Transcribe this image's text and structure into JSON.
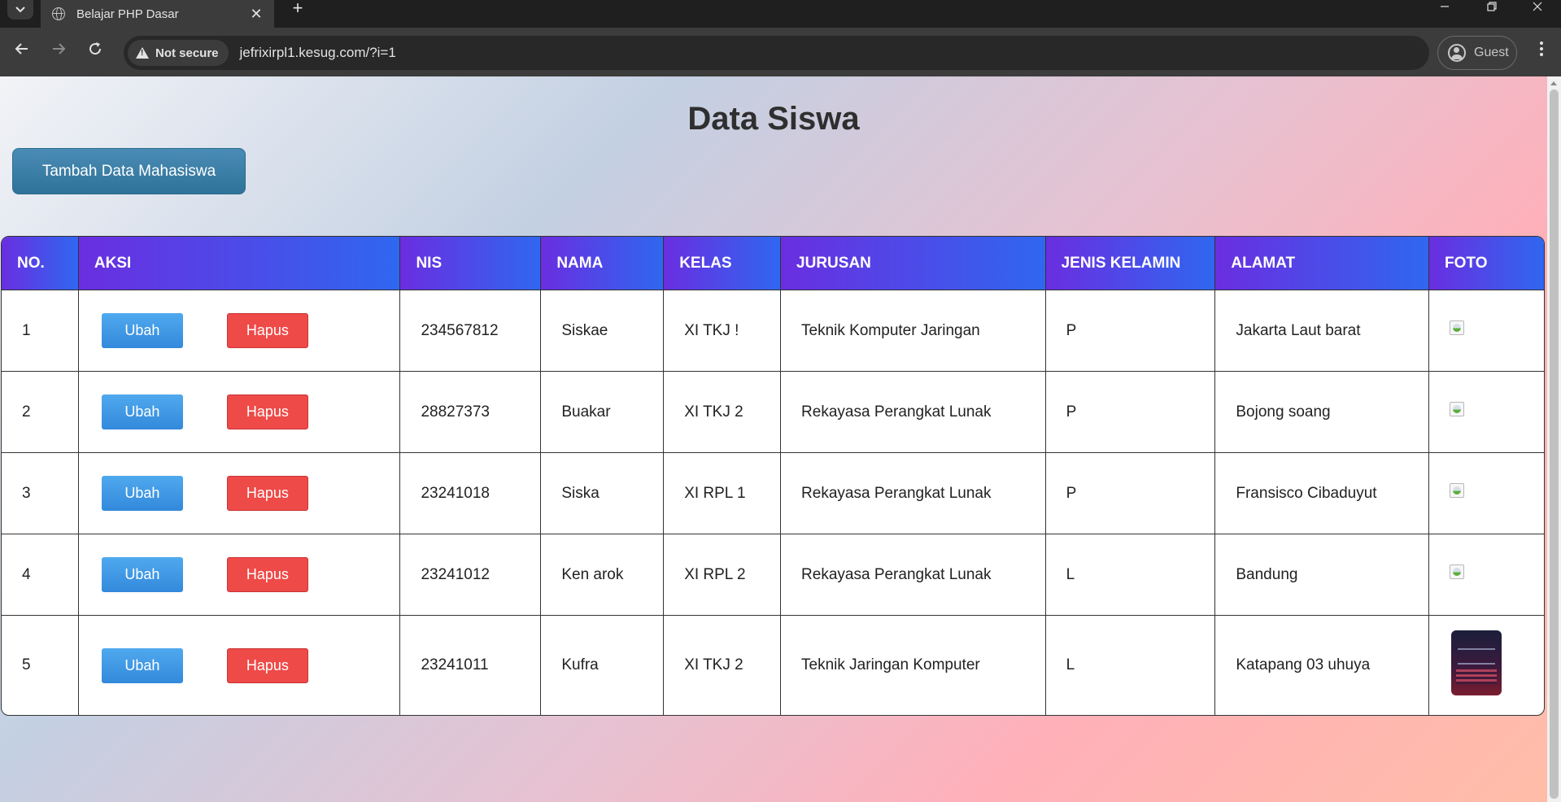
{
  "browser": {
    "tab_title": "Belajar PHP Dasar",
    "tab_close": "✕",
    "new_tab": "+",
    "security_label": "Not secure",
    "url": "jefrixirpl1.kesug.com/?i=1",
    "profile_label": "Guest",
    "icons": {
      "tab_search": "chevron-down-icon",
      "back": "arrow-left-icon",
      "forward": "arrow-right-icon",
      "reload": "reload-icon",
      "menu": "kebab-menu-icon"
    }
  },
  "page": {
    "title": "Data Siswa",
    "add_button_label": "Tambah Data Mahasiswa"
  },
  "table": {
    "headers": [
      "NO.",
      "AKSI",
      "NIS",
      "NAMA",
      "KELAS",
      "JURUSAN",
      "JENIS KELAMIN",
      "ALAMAT",
      "FOTO"
    ],
    "edit_label": "Ubah",
    "delete_label": "Hapus",
    "rows": [
      {
        "no": "1",
        "nis": "234567812",
        "nama": "Siskae",
        "kelas": "XI TKJ !",
        "jurusan": "Teknik Komputer Jaringan",
        "jk": "P",
        "alamat": "Jakarta Laut barat",
        "foto": "broken-image-icon"
      },
      {
        "no": "2",
        "nis": "28827373",
        "nama": "Buakar",
        "kelas": "XI TKJ 2",
        "jurusan": "Rekayasa Perangkat Lunak",
        "jk": "P",
        "alamat": "Bojong soang",
        "foto": "broken-image-icon"
      },
      {
        "no": "3",
        "nis": "23241018",
        "nama": "Siska",
        "kelas": "XI RPL 1",
        "jurusan": "Rekayasa Perangkat Lunak",
        "jk": "P",
        "alamat": "Fransisco Cibaduyut",
        "foto": "broken-image-icon"
      },
      {
        "no": "4",
        "nis": "23241012",
        "nama": "Ken arok",
        "kelas": "XI RPL 2",
        "jurusan": "Rekayasa Perangkat Lunak",
        "jk": "L",
        "alamat": "Bandung",
        "foto": "broken-image-icon"
      },
      {
        "no": "5",
        "nis": "23241011",
        "nama": "Kufra",
        "kelas": "XI TKJ 2",
        "jurusan": "Teknik Jaringan Komputer",
        "jk": "L",
        "alamat": "Katapang 03 uhuya",
        "foto": "photo-thumbnail"
      }
    ]
  },
  "colors": {
    "header_gradient_start": "#6a2ee0",
    "header_gradient_end": "#2f67f0",
    "edit_button": "#3389db",
    "delete_button": "#ee4a48",
    "add_button": "#2f7298"
  }
}
